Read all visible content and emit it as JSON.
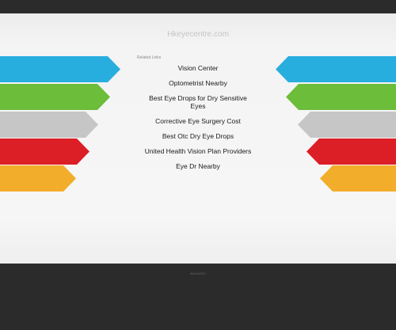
{
  "site": {
    "name": "Hkeyecentre.com"
  },
  "related": {
    "label": "Related Links",
    "links": [
      "Vision Center",
      "Optometrist Nearby",
      "Best Eye Drops for Dry Sensitive Eyes",
      "Corrective Eye Surgery Cost",
      "Best Otc Dry Eye Drops",
      "United Health Vision Plan Providers",
      "Eye Dr Nearby"
    ]
  },
  "footer": {
    "text": "Ibivnc2024"
  },
  "colors": {
    "blue": "#28aede",
    "green": "#6cbd3a",
    "gray": "#c6c6c6",
    "red": "#dc1f26",
    "orange": "#f2ad2a"
  }
}
